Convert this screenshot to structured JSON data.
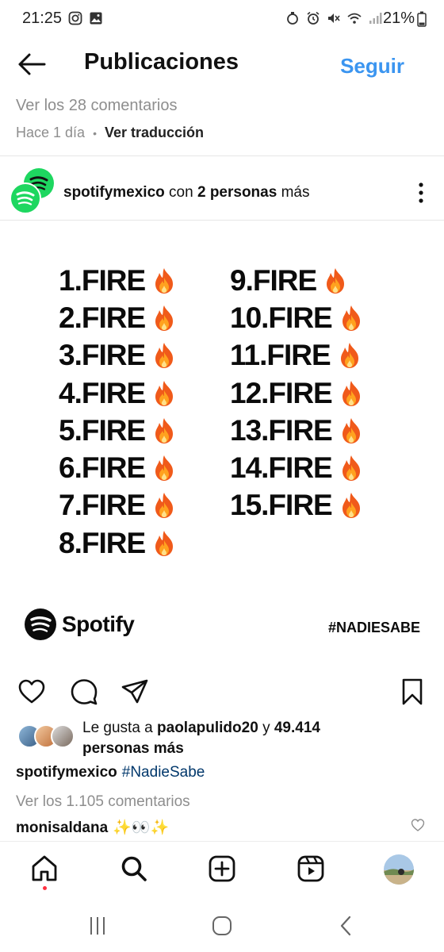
{
  "status_bar": {
    "time": "21:25",
    "battery": "21%",
    "left_icons": [
      "instagram-icon",
      "gallery-icon"
    ],
    "right_icons": [
      "data-saver-icon",
      "alarm-icon",
      "mute-icon",
      "wifi-icon",
      "signal-icon"
    ]
  },
  "header": {
    "title": "Publicaciones",
    "follow_label": "Seguir",
    "accent_color": "#3b95f0"
  },
  "previous_post": {
    "comments_link": "Ver los 28 comentarios",
    "time_ago": "Hace 1 día",
    "separator": "•",
    "translate_label": "Ver traducción"
  },
  "post": {
    "author": "spotifymexico",
    "collab_prefix": "con",
    "collab_count": "2 personas",
    "collab_suffix": "más",
    "image": {
      "left_column": [
        "1.FIRE",
        "2.FIRE",
        "3.FIRE",
        "4.FIRE",
        "5.FIRE",
        "6.FIRE",
        "7.FIRE",
        "8.FIRE"
      ],
      "right_column": [
        "9.FIRE",
        "10.FIRE",
        "11.FIRE",
        "12.FIRE",
        "13.FIRE",
        "14.FIRE",
        "15.FIRE"
      ],
      "emoji": "fire-emoji",
      "brand": "Spotify",
      "hashtag": "#NADIESABE",
      "brand_color": "#1ed760"
    },
    "likes": {
      "prefix": "Le gusta a",
      "user": "paolapulido20",
      "joiner": "y",
      "count": "49.414",
      "suffix": "personas más"
    },
    "caption": {
      "user": "spotifymexico",
      "hashtag": "#NadieSabe"
    },
    "view_comments": "Ver los 1.105 comentarios",
    "comment": {
      "user": "monisaldana",
      "text": "✨👀✨"
    }
  },
  "bottom_nav": {
    "items": [
      "home-icon",
      "search-icon",
      "create-icon",
      "reels-icon",
      "profile-avatar"
    ]
  },
  "system_nav": {
    "items": [
      "recents-icon",
      "home-button-icon",
      "back-icon"
    ]
  }
}
